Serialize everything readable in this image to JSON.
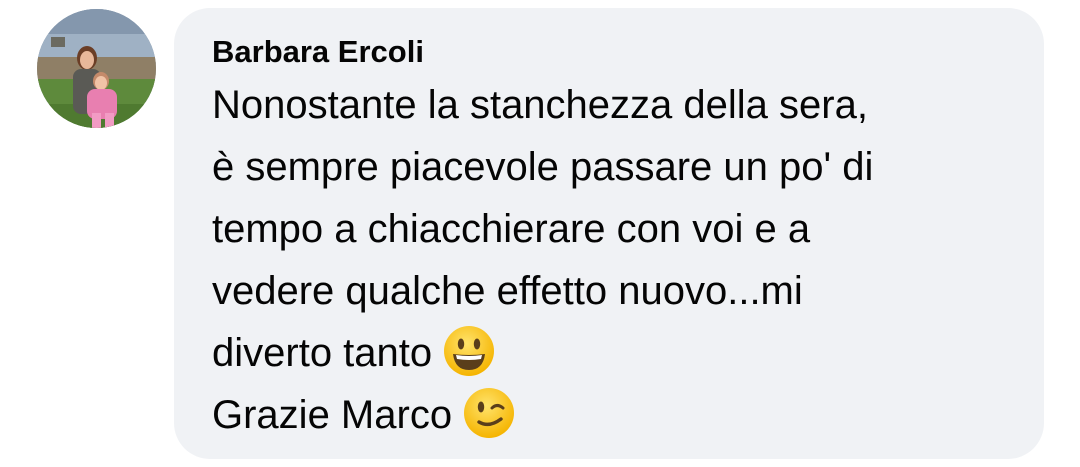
{
  "comment": {
    "author": "Barbara Ercoli",
    "lines": [
      "Nonostante la stanchezza della sera,",
      "è sempre piacevole passare un po' di",
      "tempo a chiacchierare con voi e a",
      "vedere qualche effetto nuovo...mi",
      "diverto tanto",
      "Grazie Marco"
    ],
    "emojis": [
      "grinning-face-emoji",
      "winking-face-emoji"
    ]
  },
  "colors": {
    "bubble_background": "#f0f2f5",
    "text": "#050505",
    "emoji_yellow": "#ffcc33"
  }
}
